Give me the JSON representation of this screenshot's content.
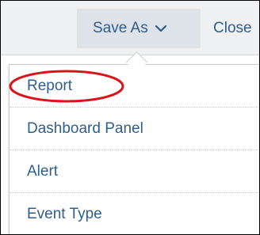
{
  "toolbar": {
    "save_as_label": "Save As",
    "close_label": "Close",
    "chevron_icon": "chevron-down-icon"
  },
  "menu": {
    "items": [
      {
        "label": "Report",
        "highlighted": true
      },
      {
        "label": "Dashboard Panel"
      },
      {
        "label": "Alert"
      },
      {
        "label": "Event Type"
      }
    ]
  },
  "colors": {
    "link": "#2f5e8c",
    "toolbar_bg": "#eef0f1",
    "button_bg": "#dde3e8",
    "annotation": "#d9141b"
  }
}
